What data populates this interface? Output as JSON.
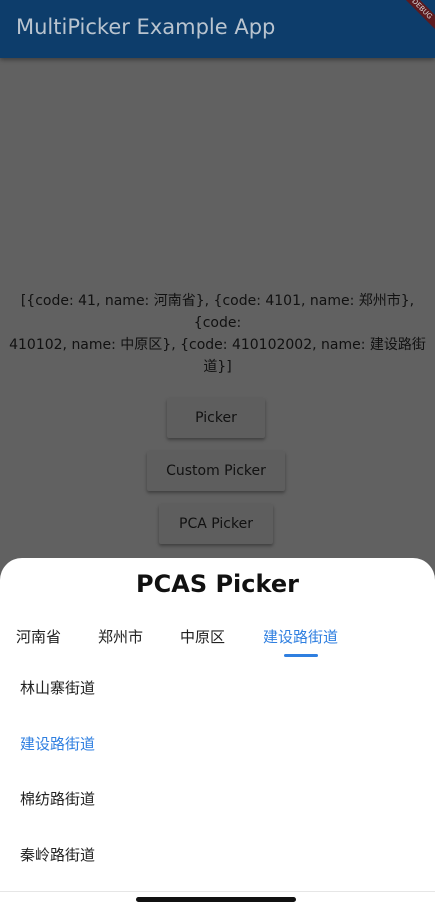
{
  "app_bar": {
    "title": "MultiPicker Example App",
    "debug_label": "DEBUG"
  },
  "result": {
    "line1": "[{code: 41, name: 河南省}, {code: 4101, name: 郑州市}, {code:",
    "line2": "410102, name: 中原区}, {code: 410102002, name: 建设路街道}]"
  },
  "buttons": {
    "picker": "Picker",
    "custom_picker": "Custom Picker",
    "pca_picker": "PCA Picker"
  },
  "sheet": {
    "title": "PCAS Picker",
    "tabs": [
      {
        "label": "河南省",
        "active": false
      },
      {
        "label": "郑州市",
        "active": false
      },
      {
        "label": "中原区",
        "active": false
      },
      {
        "label": "建设路街道",
        "active": true
      }
    ],
    "items": [
      {
        "label": "林山寨街道",
        "selected": false
      },
      {
        "label": "建设路街道",
        "selected": true
      },
      {
        "label": "棉纺路街道",
        "selected": false
      },
      {
        "label": "秦岭路街道",
        "selected": false
      }
    ]
  },
  "colors": {
    "app_bar": "#0d3d6b",
    "accent": "#2f7fe0",
    "scrim": "#616161"
  }
}
